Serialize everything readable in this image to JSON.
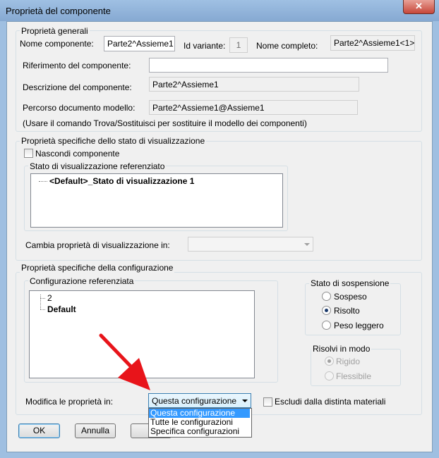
{
  "window": {
    "title": "Proprietà del componente",
    "close_glyph": "✕"
  },
  "general": {
    "group_title": "Proprietà generali",
    "component_name_label": "Nome componente:",
    "component_name_value": "Parte2^Assieme1",
    "instance_id_label": "Id variante:",
    "instance_id_value": "1",
    "full_name_label": "Nome completo:",
    "full_name_value": "Parte2^Assieme1<1>",
    "reference_label": "Riferimento del componente:",
    "reference_value": "",
    "description_label": "Descrizione del componente:",
    "description_value": "Parte2^Assieme1",
    "path_label": "Percorso documento modello:",
    "path_value": "Parte2^Assieme1@Assieme1",
    "note": "(Usare il comando Trova/Sostituisci per sostituire il modello dei componenti)"
  },
  "display_state": {
    "group_title": "Proprietà specifiche dello stato di visualizzazione",
    "hide_label": "Nascondi componente",
    "hide_checked": false,
    "list_title": "Stato di visualizzazione referenziato",
    "list_items": [
      "<Default>_Stato di visualizzazione 1"
    ],
    "change_label": "Cambia proprietà di visualizzazione in:",
    "change_value": ""
  },
  "configuration": {
    "group_title": "Proprietà specifiche della configurazione",
    "list_title": "Configurazione referenziata",
    "list_items": [
      "2",
      "Default"
    ],
    "suppression_title": "Stato di sospensione",
    "suppression_options": [
      "Sospeso",
      "Risolto",
      "Peso leggero"
    ],
    "suppression_selected": "Risolto",
    "solve_title": "Risolvi in modo",
    "solve_options": [
      "Rigido",
      "Flessibile"
    ],
    "solve_selected": "Rigido",
    "modify_label": "Modifica le proprietà in:",
    "modify_value": "Questa configurazione",
    "modify_options": [
      "Questa configurazione",
      "Tutte le configurazioni",
      "Specifica configurazioni"
    ],
    "exclude_label": "Escludi dalla distinta materiali",
    "exclude_checked": false
  },
  "buttons": {
    "ok": "OK",
    "cancel": "Annulla"
  },
  "colors": {
    "selection": "#3399ff",
    "arrow": "#e8141a",
    "titlebar": "#9fc0e3"
  }
}
